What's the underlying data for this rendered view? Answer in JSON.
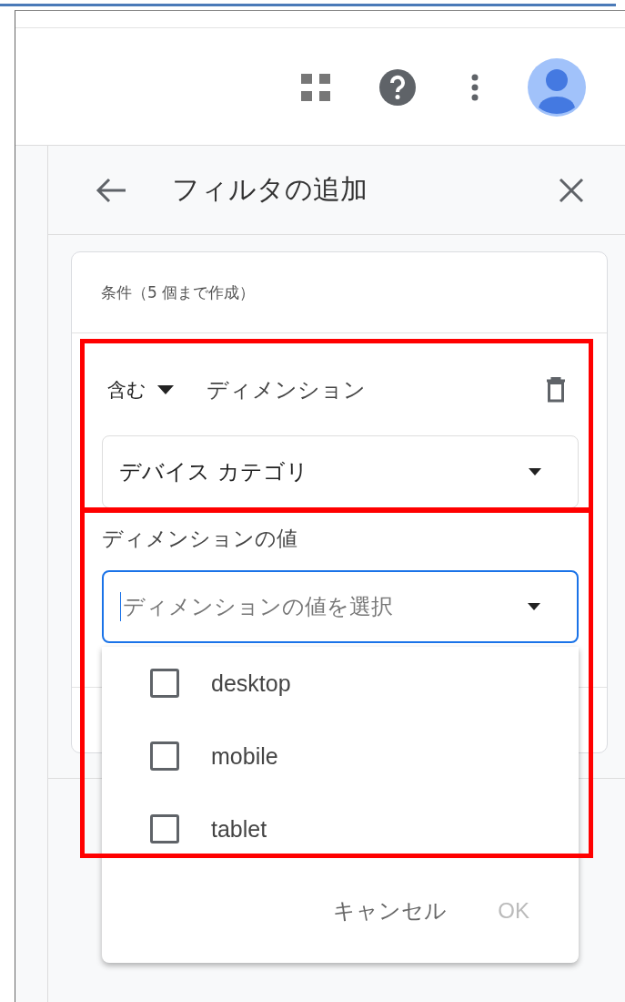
{
  "panel": {
    "title": "フィルタの追加"
  },
  "conditions": {
    "title": "条件（5 個まで作成）",
    "operator": "含む",
    "field_label": "ディメンション",
    "dimension": "デバイス カテゴリ",
    "value_label": "ディメンションの値",
    "value_placeholder": "ディメンションの値を選択"
  },
  "options": [
    {
      "label": "desktop",
      "checked": false
    },
    {
      "label": "mobile",
      "checked": false
    },
    {
      "label": "tablet",
      "checked": false
    }
  ],
  "buttons": [
    {
      "label": "キャンセル",
      "disabled": false
    },
    {
      "label": "OK",
      "disabled": true
    }
  ]
}
